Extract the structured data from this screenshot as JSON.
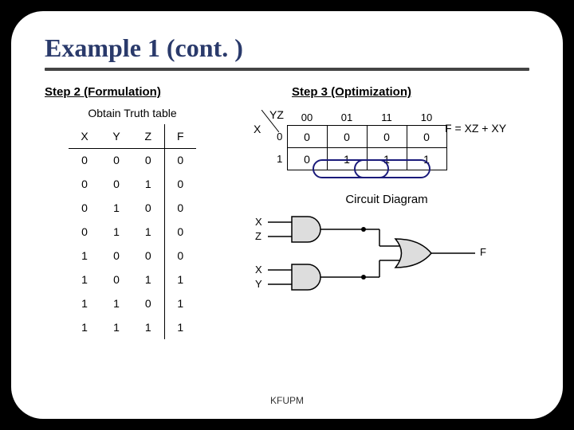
{
  "title": "Example 1 (cont. )",
  "step2": {
    "heading": "Step 2 (Formulation)",
    "subheading": "Obtain Truth table",
    "columns": [
      "X",
      "Y",
      "Z",
      "F"
    ],
    "rows": [
      [
        "0",
        "0",
        "0",
        "0"
      ],
      [
        "0",
        "0",
        "1",
        "0"
      ],
      [
        "0",
        "1",
        "0",
        "0"
      ],
      [
        "0",
        "1",
        "1",
        "0"
      ],
      [
        "1",
        "0",
        "0",
        "0"
      ],
      [
        "1",
        "0",
        "1",
        "1"
      ],
      [
        "1",
        "1",
        "0",
        "1"
      ],
      [
        "1",
        "1",
        "1",
        "1"
      ]
    ]
  },
  "step3": {
    "heading": "Step 3 (Optimization)",
    "kmap": {
      "yz_label": "YZ",
      "x_label": "X",
      "col_headers": [
        "00",
        "01",
        "11",
        "10"
      ],
      "row_headers": [
        "0",
        "1"
      ],
      "cells": [
        [
          "0",
          "0",
          "0",
          "0"
        ],
        [
          "0",
          "1",
          "1",
          "1"
        ]
      ]
    },
    "formula": "F = XZ + XY",
    "circuit_heading": "Circuit Diagram",
    "circuit": {
      "inputs_top": [
        "X",
        "Z"
      ],
      "inputs_bottom": [
        "X",
        "Y"
      ],
      "output": "F"
    }
  },
  "footer": "KFUPM"
}
